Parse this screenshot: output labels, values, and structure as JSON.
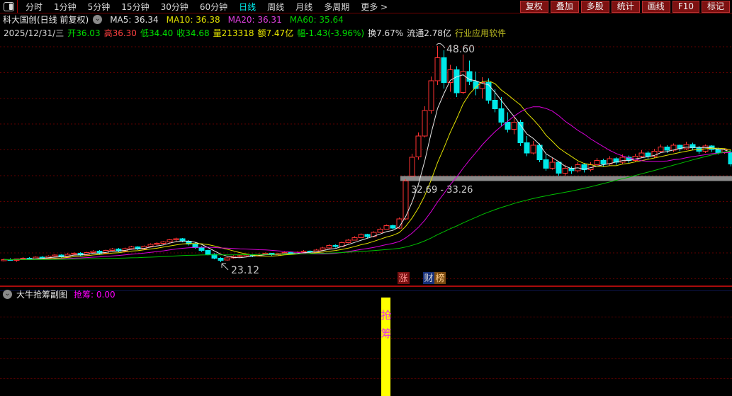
{
  "toolbar": {
    "left_items": [
      {
        "label": "分时",
        "active": false
      },
      {
        "label": "1分钟",
        "active": false
      },
      {
        "label": "5分钟",
        "active": false
      },
      {
        "label": "15分钟",
        "active": false
      },
      {
        "label": "30分钟",
        "active": false
      },
      {
        "label": "60分钟",
        "active": false
      },
      {
        "label": "日线",
        "active": true
      },
      {
        "label": "周线",
        "active": false
      },
      {
        "label": "月线",
        "active": false
      },
      {
        "label": "多周期",
        "active": false
      },
      {
        "label": "更多 >",
        "active": false
      }
    ],
    "right_items": [
      "复权",
      "叠加",
      "多股",
      "统计",
      "画线",
      "F10",
      "标记"
    ]
  },
  "icons": {
    "collapse": "⌄"
  },
  "legend": {
    "stock_title": "科大国创(日线 前复权)",
    "ma_items": [
      {
        "label": "MA5: 36.34",
        "color": "#e0e0e0"
      },
      {
        "label": "MA10: 36.38",
        "color": "#e0e000"
      },
      {
        "label": "MA20: 36.31",
        "color": "#e040e0"
      },
      {
        "label": "MA60: 35.64",
        "color": "#00d000"
      }
    ]
  },
  "quote_bar": {
    "items": [
      {
        "text": "2025/12/31/三",
        "color": "#d8d8d8",
        "link": false
      },
      {
        "text": "开36.03",
        "color": "#00e000",
        "link": false
      },
      {
        "text": "高36.30",
        "color": "#ff4040",
        "link": false
      },
      {
        "text": "低34.40",
        "color": "#00e000",
        "link": false
      },
      {
        "text": "收34.68",
        "color": "#00e000",
        "link": false
      },
      {
        "text": "量213318",
        "color": "#e8e800",
        "link": false
      },
      {
        "text": "额7.47亿",
        "color": "#e8e800",
        "link": false
      },
      {
        "text": "幅-1.43(-3.96%)",
        "color": "#00e000",
        "link": false
      },
      {
        "text": "换7.67%",
        "color": "#e0e0e0",
        "link": false
      },
      {
        "text": "流通2.78亿",
        "color": "#e0e0e0",
        "link": false
      },
      {
        "text": "行业应用软件",
        "color": "#b8b820",
        "link": true
      }
    ]
  },
  "chart_data": {
    "type": "candlestick",
    "title": "科大国创 日线 前复权",
    "price_high": 48.6,
    "price_low": 23.12,
    "ma_periods": [
      5,
      10,
      20,
      60
    ],
    "annotations": {
      "high": "48.60",
      "low": "23.12",
      "gap": "32.69 - 33.26"
    },
    "gap_band": {
      "from": 32.69,
      "to": 33.26
    },
    "badges": [
      {
        "label": "涨",
        "bg": "#7a1010",
        "color": "#ff9090"
      },
      {
        "label": "财",
        "bg": "#16307a",
        "color": "#d8d8d8"
      },
      {
        "label": "榜",
        "bg": "#7a4a10",
        "color": "#ffcc88"
      }
    ],
    "colors": {
      "up": "#ff3232",
      "down": "#00e8e8",
      "ma5": "#e8e8e8",
      "ma10": "#e0e000",
      "ma20": "#d800d8",
      "ma60": "#00c000",
      "grid": "#5f0000",
      "band": "#8a8a8a",
      "annotation": "#c8c8c8"
    },
    "candles": [
      [
        23.3,
        23.55,
        23.2,
        23.42
      ],
      [
        23.42,
        23.6,
        23.3,
        23.35
      ],
      [
        23.35,
        23.5,
        23.15,
        23.48
      ],
      [
        23.48,
        23.7,
        23.4,
        23.6
      ],
      [
        23.6,
        23.72,
        23.38,
        23.45
      ],
      [
        23.45,
        23.8,
        23.4,
        23.72
      ],
      [
        23.72,
        23.85,
        23.52,
        23.58
      ],
      [
        23.58,
        23.9,
        23.5,
        23.82
      ],
      [
        23.82,
        24.05,
        23.7,
        23.95
      ],
      [
        23.95,
        24.05,
        23.65,
        23.75
      ],
      [
        23.75,
        24.15,
        23.7,
        24.05
      ],
      [
        24.05,
        24.3,
        23.95,
        24.18
      ],
      [
        24.18,
        24.28,
        23.85,
        23.95
      ],
      [
        23.95,
        24.35,
        23.9,
        24.25
      ],
      [
        24.25,
        24.55,
        24.15,
        24.42
      ],
      [
        24.42,
        24.55,
        24.05,
        24.15
      ],
      [
        24.15,
        24.6,
        24.1,
        24.5
      ],
      [
        24.5,
        24.8,
        24.4,
        24.68
      ],
      [
        24.68,
        24.78,
        24.3,
        24.42
      ],
      [
        24.42,
        24.85,
        24.35,
        24.72
      ],
      [
        24.72,
        25.05,
        24.6,
        24.92
      ],
      [
        24.92,
        25.0,
        24.55,
        24.65
      ],
      [
        24.65,
        25.1,
        24.6,
        25.0
      ],
      [
        25.0,
        25.35,
        24.9,
        25.22
      ],
      [
        25.22,
        25.45,
        25.05,
        25.32
      ],
      [
        25.32,
        25.6,
        25.2,
        25.5
      ],
      [
        25.5,
        25.85,
        25.4,
        25.75
      ],
      [
        25.75,
        26.0,
        25.55,
        25.88
      ],
      [
        25.88,
        25.95,
        25.45,
        25.58
      ],
      [
        25.58,
        25.7,
        25.1,
        25.25
      ],
      [
        25.25,
        25.4,
        24.7,
        24.85
      ],
      [
        24.85,
        25.0,
        24.35,
        24.48
      ],
      [
        24.48,
        24.6,
        23.9,
        24.02
      ],
      [
        24.02,
        24.15,
        23.45,
        23.58
      ],
      [
        23.58,
        23.7,
        23.12,
        23.35
      ],
      [
        23.35,
        23.75,
        23.3,
        23.62
      ],
      [
        23.62,
        23.9,
        23.55,
        23.8
      ],
      [
        23.8,
        24.0,
        23.65,
        23.88
      ],
      [
        23.88,
        24.1,
        23.78,
        24.0
      ],
      [
        24.0,
        24.08,
        23.72,
        23.85
      ],
      [
        23.85,
        24.15,
        23.8,
        24.05
      ],
      [
        24.05,
        24.25,
        23.95,
        24.15
      ],
      [
        24.15,
        24.22,
        23.88,
        23.98
      ],
      [
        23.98,
        24.2,
        23.92,
        24.12
      ],
      [
        24.12,
        24.35,
        24.05,
        24.25
      ],
      [
        24.25,
        24.32,
        24.0,
        24.1
      ],
      [
        24.1,
        24.38,
        24.05,
        24.3
      ],
      [
        24.3,
        24.52,
        24.22,
        24.42
      ],
      [
        24.42,
        24.5,
        24.18,
        24.28
      ],
      [
        24.28,
        24.65,
        24.22,
        24.55
      ],
      [
        24.55,
        24.92,
        24.48,
        24.8
      ],
      [
        24.8,
        25.22,
        24.72,
        25.1
      ],
      [
        25.1,
        25.2,
        24.82,
        24.95
      ],
      [
        24.95,
        25.55,
        24.9,
        25.42
      ],
      [
        25.42,
        25.85,
        25.35,
        25.72
      ],
      [
        25.72,
        26.15,
        25.65,
        26.02
      ],
      [
        26.02,
        26.5,
        25.95,
        26.38
      ],
      [
        26.38,
        26.48,
        25.98,
        26.12
      ],
      [
        26.12,
        26.75,
        26.05,
        26.62
      ],
      [
        26.62,
        27.15,
        26.55,
        27.02
      ],
      [
        27.02,
        27.55,
        26.95,
        27.42
      ],
      [
        27.42,
        27.55,
        26.95,
        27.12
      ],
      [
        27.12,
        28.4,
        27.05,
        28.22
      ],
      [
        28.22,
        32.9,
        28.1,
        32.69
      ],
      [
        33.26,
        35.9,
        33.26,
        35.5
      ],
      [
        35.5,
        38.4,
        35.2,
        38.0
      ],
      [
        38.0,
        41.5,
        37.8,
        41.0
      ],
      [
        41.0,
        45.0,
        40.6,
        44.5
      ],
      [
        44.5,
        48.6,
        44.0,
        47.2
      ],
      [
        47.2,
        48.1,
        43.6,
        44.3
      ],
      [
        44.3,
        46.4,
        43.2,
        45.8
      ],
      [
        45.8,
        46.2,
        42.6,
        43.1
      ],
      [
        43.1,
        47.6,
        42.9,
        45.6
      ],
      [
        45.6,
        46.9,
        44.0,
        44.4
      ],
      [
        44.4,
        45.6,
        42.8,
        43.6
      ],
      [
        43.6,
        44.9,
        42.4,
        44.3
      ],
      [
        44.3,
        44.8,
        41.8,
        42.2
      ],
      [
        42.2,
        43.5,
        40.8,
        41.2
      ],
      [
        41.2,
        42.6,
        39.2,
        39.6
      ],
      [
        39.6,
        40.8,
        38.4,
        38.8
      ],
      [
        38.8,
        40.2,
        38.2,
        39.6
      ],
      [
        39.6,
        39.9,
        36.8,
        37.2
      ],
      [
        37.2,
        38.0,
        35.6,
        36.0
      ],
      [
        36.0,
        37.4,
        35.8,
        36.9
      ],
      [
        36.9,
        37.1,
        34.9,
        35.2
      ],
      [
        35.2,
        35.8,
        33.9,
        34.2
      ],
      [
        34.2,
        35.4,
        34.0,
        34.9
      ],
      [
        34.9,
        35.0,
        33.3,
        33.6
      ],
      [
        33.6,
        34.6,
        33.3,
        34.2
      ],
      [
        34.2,
        34.4,
        33.5,
        33.9
      ],
      [
        33.9,
        34.9,
        33.7,
        34.6
      ],
      [
        34.6,
        34.8,
        33.7,
        34.0
      ],
      [
        34.0,
        34.9,
        33.8,
        34.6
      ],
      [
        34.6,
        35.4,
        34.4,
        35.1
      ],
      [
        35.1,
        35.3,
        34.4,
        34.7
      ],
      [
        34.7,
        35.6,
        34.5,
        35.3
      ],
      [
        35.3,
        35.5,
        34.6,
        34.9
      ],
      [
        34.9,
        35.8,
        34.7,
        35.5
      ],
      [
        35.5,
        35.7,
        34.8,
        35.1
      ],
      [
        35.1,
        35.9,
        34.9,
        35.6
      ],
      [
        35.6,
        36.3,
        35.4,
        36.0
      ],
      [
        36.0,
        36.2,
        35.3,
        35.6
      ],
      [
        35.6,
        36.5,
        35.4,
        36.2
      ],
      [
        36.2,
        37.0,
        36.0,
        36.7
      ],
      [
        36.7,
        36.9,
        36.0,
        36.3
      ],
      [
        36.3,
        37.1,
        36.1,
        36.9
      ],
      [
        36.9,
        37.0,
        36.2,
        36.5
      ],
      [
        36.5,
        37.3,
        36.3,
        37.0
      ],
      [
        37.0,
        37.2,
        36.3,
        36.6
      ],
      [
        36.6,
        36.8,
        35.9,
        36.2
      ],
      [
        36.2,
        37.0,
        36.0,
        36.8
      ],
      [
        36.8,
        36.9,
        36.1,
        36.4
      ],
      [
        36.4,
        36.6,
        35.8,
        36.03
      ],
      [
        36.03,
        36.5,
        35.9,
        36.35
      ],
      [
        36.03,
        36.3,
        34.4,
        34.68
      ]
    ]
  },
  "sub_panel": {
    "title": "大牛抢筹副图",
    "indicator_label": "抢筹:",
    "indicator_value": "0.00",
    "signal_bar_label": "抢筹",
    "colors": {
      "bar": "#ffff00",
      "label": "#e82ae8"
    }
  }
}
